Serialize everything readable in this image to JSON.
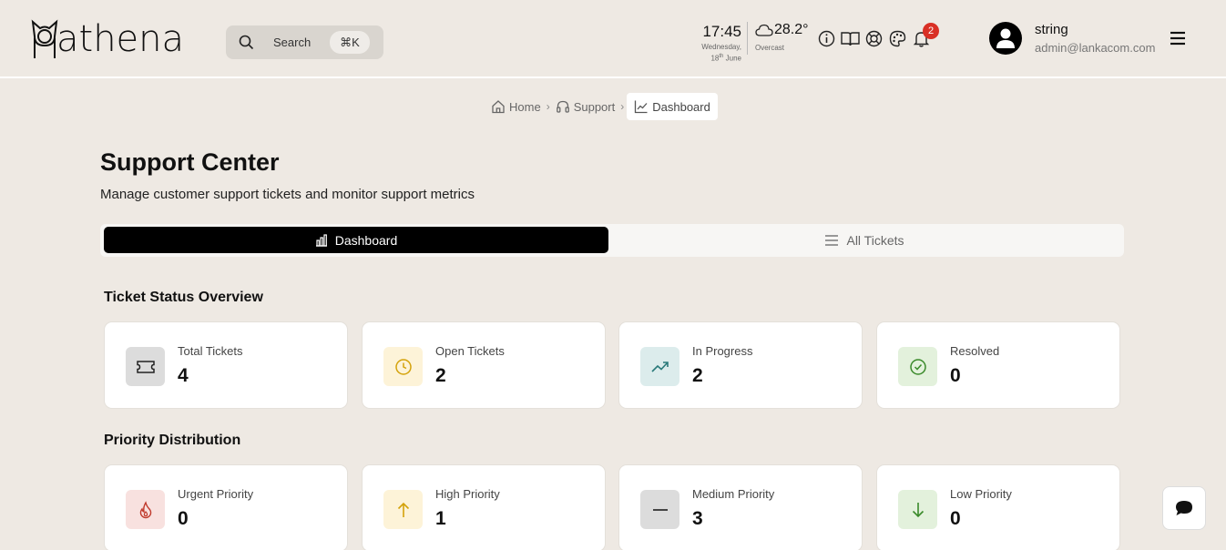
{
  "app": {
    "name": "athena"
  },
  "search": {
    "label": "Search",
    "shortcut": "⌘K"
  },
  "clock": {
    "time": "17:45",
    "day": "Wednesday,",
    "date_prefix": "18",
    "date_suffix": "th",
    "month": "June"
  },
  "weather": {
    "temp": "28.2°",
    "condition": "Overcast"
  },
  "notifications": {
    "count": "2"
  },
  "user": {
    "name": "string",
    "email": "admin@lankacom.com"
  },
  "breadcrumb": {
    "home": "Home",
    "support": "Support",
    "current": "Dashboard"
  },
  "page": {
    "title": "Support Center",
    "subtitle": "Manage customer support tickets and monitor support metrics"
  },
  "tabs": {
    "dashboard": "Dashboard",
    "all_tickets": "All Tickets"
  },
  "status_section": {
    "title": "Ticket Status Overview",
    "cards": [
      {
        "label": "Total Tickets",
        "value": "4",
        "icon": "ticket-icon",
        "color": "#dcdcdc"
      },
      {
        "label": "Open Tickets",
        "value": "2",
        "icon": "clock-icon",
        "color": "#fdf3d8"
      },
      {
        "label": "In Progress",
        "value": "2",
        "icon": "trending-up-icon",
        "color": "#dcecec"
      },
      {
        "label": "Resolved",
        "value": "0",
        "icon": "check-circle-icon",
        "color": "#e3f1dc"
      }
    ]
  },
  "priority_section": {
    "title": "Priority Distribution",
    "cards": [
      {
        "label": "Urgent Priority",
        "value": "0",
        "icon": "flame-icon",
        "color": "#f8e1df"
      },
      {
        "label": "High Priority",
        "value": "1",
        "icon": "arrow-up-icon",
        "color": "#fdf3d8"
      },
      {
        "label": "Medium Priority",
        "value": "3",
        "icon": "minus-icon",
        "color": "#dcdcdc"
      },
      {
        "label": "Low Priority",
        "value": "0",
        "icon": "arrow-down-icon",
        "color": "#e3f1dc"
      }
    ]
  }
}
